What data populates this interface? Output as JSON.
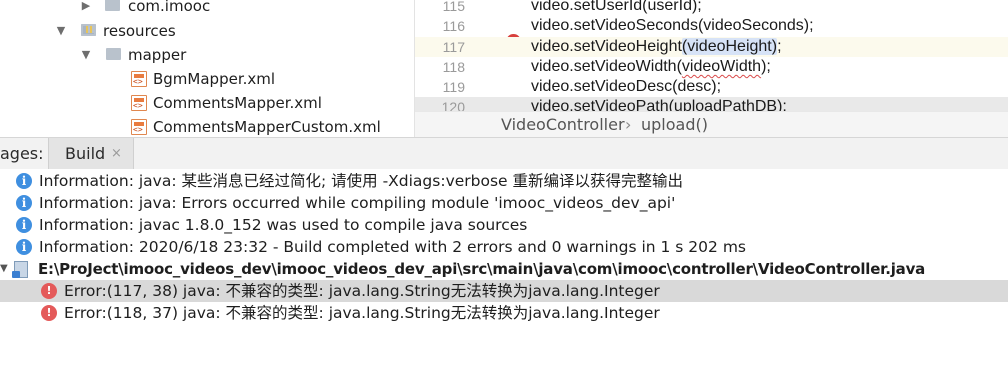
{
  "tree": {
    "items": [
      {
        "label": "com.imooc",
        "icon": "package-folder-icon",
        "expanded": false
      },
      {
        "label": "resources",
        "icon": "resources-folder-icon",
        "expanded": true
      },
      {
        "label": "mapper",
        "icon": "folder-icon",
        "expanded": true
      },
      {
        "label": "BgmMapper.xml",
        "icon": "xml-file-icon"
      },
      {
        "label": "CommentsMapper.xml",
        "icon": "xml-file-icon"
      },
      {
        "label": "CommentsMapperCustom.xml",
        "icon": "xml-file-icon"
      }
    ]
  },
  "editor": {
    "lines": [
      {
        "num": "115",
        "code": "video.setUserId(userId);"
      },
      {
        "num": "116",
        "code": "video.setVideoSeconds(videoSeconds);"
      },
      {
        "num": "117",
        "code_pre": "video.setVideoHeight",
        "code_hl": "(videoHeight)",
        "code_post": ";"
      },
      {
        "num": "118",
        "code_pre": "video.setVideoWidth(",
        "code_err": "videoWidth",
        "code_post": ");"
      },
      {
        "num": "119",
        "code": "video.setVideoDesc(desc);"
      },
      {
        "num": "120",
        "code": "video.setVideoPath(uploadPathDB);"
      }
    ],
    "error_marker": "!",
    "breadcrumbs": {
      "class": "VideoController",
      "separator": "›",
      "method": "upload()"
    }
  },
  "tool_window": {
    "label": "ages:",
    "tab_label": "Build",
    "tab_close": "×"
  },
  "messages": {
    "info": [
      "Information: java: 某些消息已经过简化; 请使用 -Xdiags:verbose 重新编译以获得完整输出",
      "Information: java: Errors occurred while compiling module 'imooc_videos_dev_api'",
      "Information: javac 1.8.0_152 was used to compile java sources",
      "Information: 2020/6/18 23:32 - Build completed with 2 errors and 0 warnings in 1 s 202 ms"
    ],
    "file_path": "E:\\ProJect\\imooc_videos_dev\\imooc_videos_dev_api\\src\\main\\java\\com\\imooc\\controller\\VideoController.java",
    "errors": [
      "Error:(117, 38)  java: 不兼容的类型: java.lang.String无法转换为java.lang.Integer",
      "Error:(118, 37)  java: 不兼容的类型: java.lang.String无法转换为java.lang.Integer"
    ]
  },
  "colors": {
    "info_icon": "#3f8fe0",
    "error_icon": "#e45a5a",
    "selection": "#d9d9d9",
    "current_line": "#fcfaed"
  }
}
